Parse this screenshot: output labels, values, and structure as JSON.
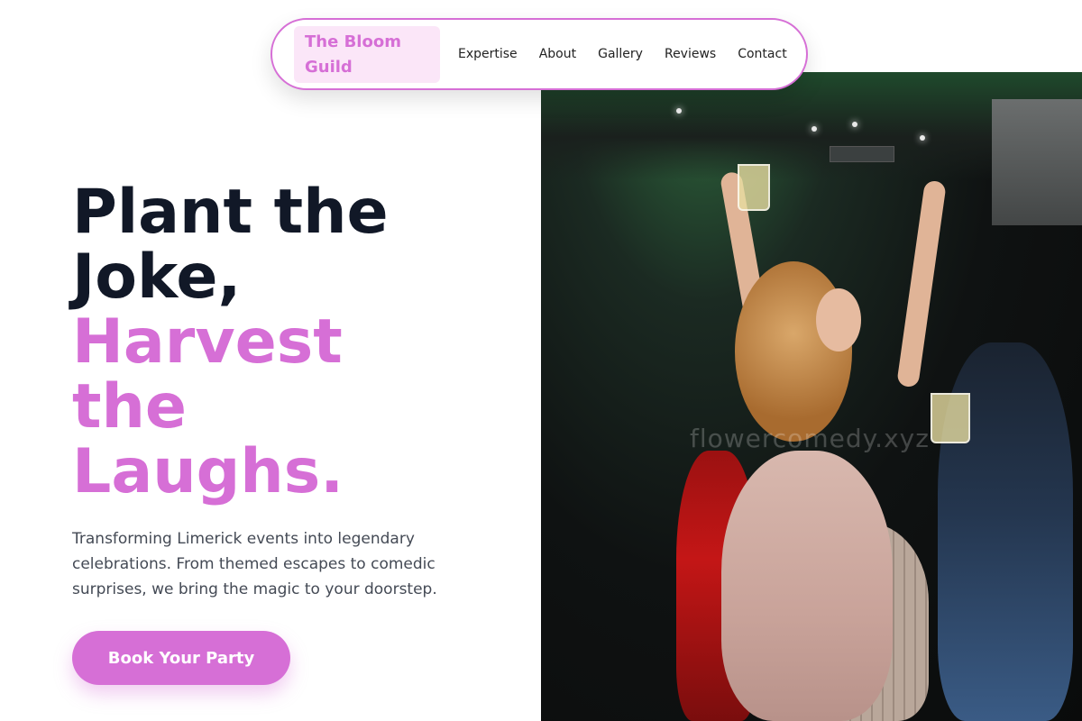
{
  "brand": {
    "name": "The Bloom Guild"
  },
  "nav": {
    "links": [
      "Expertise",
      "About",
      "Gallery",
      "Reviews",
      "Contact"
    ]
  },
  "hero": {
    "headline_line1": "Plant the",
    "headline_line2": "Joke,",
    "headline_accent1": "Harvest",
    "headline_accent2": "the",
    "headline_accent3": "Laughs.",
    "description": "Transforming Limerick events into legendary celebrations. From themed escapes to comedic surprises, we bring the magic to your doorstep.",
    "cta_label": "Book Your Party",
    "image_watermark": "flowercomedy.xyz"
  },
  "colors": {
    "accent": "#d66fd6",
    "brand_bg": "#fbe6f8",
    "heading": "#111827",
    "body_text": "#444a55"
  }
}
